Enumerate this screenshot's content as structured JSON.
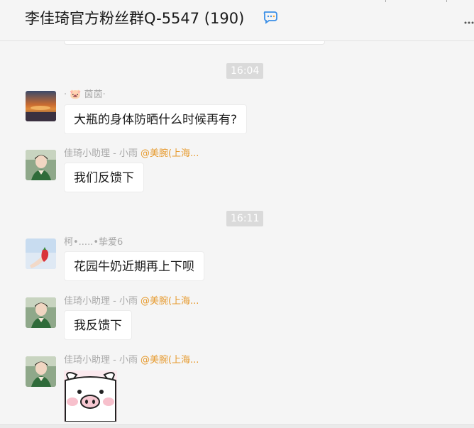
{
  "header": {
    "title": "李佳琦官方粉丝群Q-5547 (190)",
    "title_icon": "group-chat-icon",
    "more_icon": "more-options-icon"
  },
  "chat": {
    "times": [
      "16:04",
      "16:11"
    ],
    "messages": [
      {
        "sender": "· 🐷 茵茵·",
        "mention": "",
        "text": "大瓶的身体防晒什么时候再有?",
        "avatar": "sunset-avatar"
      },
      {
        "sender": "佳琦小助理 - 小雨",
        "mention": "@美腕(上海...",
        "text": "我们反馈下",
        "avatar": "assistant-avatar"
      },
      {
        "sender": "柯•.....•挚爱6",
        "mention": "",
        "text": "花园牛奶近期再上下呗",
        "avatar": "strawberry-avatar"
      },
      {
        "sender": "佳琦小助理 - 小雨",
        "mention": "@美腕(上海...",
        "text": "我反馈下",
        "avatar": "assistant-avatar"
      },
      {
        "sender": "佳琦小助理 - 小雨",
        "mention": "@美腕(上海...",
        "text": "",
        "avatar": "assistant-avatar",
        "sticker": "pig-sticker"
      }
    ]
  },
  "colors": {
    "background": "#f5f5f5",
    "bubble": "#ffffff",
    "sender_name": "#a8a8a8",
    "mention": "#e69a2e",
    "time_badge": "#dadada"
  }
}
